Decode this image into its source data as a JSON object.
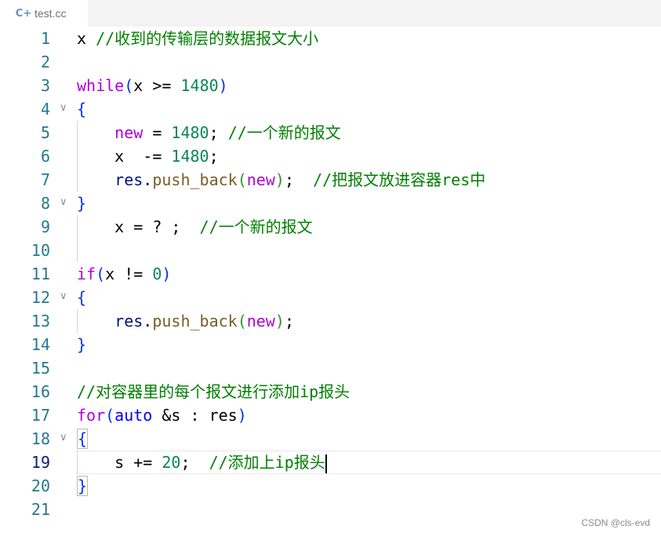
{
  "tab": {
    "title": "test.cc",
    "icon": "cpp-file-icon"
  },
  "watermark": "CSDN @cls-evd",
  "current_line": 19,
  "lines": [
    {
      "n": "1",
      "text": "x //收到的传输层的数据报文大小"
    },
    {
      "n": "2",
      "text": ""
    },
    {
      "n": "3",
      "text": "while(x >= 1480)"
    },
    {
      "n": "4",
      "text": "{"
    },
    {
      "n": "5",
      "text": "    new = 1480; //一个新的报文"
    },
    {
      "n": "6",
      "text": "    x  -= 1480;"
    },
    {
      "n": "7",
      "text": "    res.push_back(new);  //把报文放进容器res中"
    },
    {
      "n": "8",
      "text": "}"
    },
    {
      "n": "9",
      "text": "    x = ? ;  //一个新的报文"
    },
    {
      "n": "10",
      "text": ""
    },
    {
      "n": "11",
      "text": "if(x != 0)"
    },
    {
      "n": "12",
      "text": "{"
    },
    {
      "n": "13",
      "text": "    res.push_back(new);"
    },
    {
      "n": "14",
      "text": "}"
    },
    {
      "n": "15",
      "text": ""
    },
    {
      "n": "16",
      "text": "//对容器里的每个报文进行添加ip报头"
    },
    {
      "n": "17",
      "text": "for(auto &s : res)"
    },
    {
      "n": "18",
      "text": "{"
    },
    {
      "n": "19",
      "text": "    s += 20;  //添加上ip报头"
    },
    {
      "n": "20",
      "text": "}"
    },
    {
      "n": "21",
      "text": ""
    }
  ],
  "tokens": {
    "l1": [
      {
        "t": "x ",
        "c": ""
      },
      {
        "t": "//收到的传输层的数据报文大小",
        "c": "c"
      }
    ],
    "l3": [
      {
        "t": "while",
        "c": "k"
      },
      {
        "t": "(",
        "c": "b1"
      },
      {
        "t": "x >= ",
        "c": ""
      },
      {
        "t": "1480",
        "c": "n"
      },
      {
        "t": ")",
        "c": "b1"
      }
    ],
    "l4": [
      {
        "t": "{",
        "c": "b1"
      }
    ],
    "l5": [
      {
        "t": "    ",
        "c": ""
      },
      {
        "t": "new",
        "c": "k"
      },
      {
        "t": " = ",
        "c": ""
      },
      {
        "t": "1480",
        "c": "n"
      },
      {
        "t": "; ",
        "c": ""
      },
      {
        "t": "//一个新的报文",
        "c": "c"
      }
    ],
    "l6": [
      {
        "t": "    x  -= ",
        "c": ""
      },
      {
        "t": "1480",
        "c": "n"
      },
      {
        "t": ";",
        "c": ""
      }
    ],
    "l7": [
      {
        "t": "    ",
        "c": ""
      },
      {
        "t": "res",
        "c": "v"
      },
      {
        "t": ".",
        "c": ""
      },
      {
        "t": "push_back",
        "c": "f"
      },
      {
        "t": "(",
        "c": "b2"
      },
      {
        "t": "new",
        "c": "k"
      },
      {
        "t": ")",
        "c": "b2"
      },
      {
        "t": ";  ",
        "c": ""
      },
      {
        "t": "//把报文放进容器res中",
        "c": "c"
      }
    ],
    "l8": [
      {
        "t": "}",
        "c": "b1"
      }
    ],
    "l9": [
      {
        "t": "    x = ? ;  ",
        "c": ""
      },
      {
        "t": "//一个新的报文",
        "c": "c"
      }
    ],
    "l11": [
      {
        "t": "if",
        "c": "k"
      },
      {
        "t": "(",
        "c": "b1"
      },
      {
        "t": "x != ",
        "c": ""
      },
      {
        "t": "0",
        "c": "n"
      },
      {
        "t": ")",
        "c": "b1"
      }
    ],
    "l12": [
      {
        "t": "{",
        "c": "b1"
      }
    ],
    "l13": [
      {
        "t": "    ",
        "c": ""
      },
      {
        "t": "res",
        "c": "v"
      },
      {
        "t": ".",
        "c": ""
      },
      {
        "t": "push_back",
        "c": "f"
      },
      {
        "t": "(",
        "c": "b2"
      },
      {
        "t": "new",
        "c": "k"
      },
      {
        "t": ")",
        "c": "b2"
      },
      {
        "t": ";",
        "c": ""
      }
    ],
    "l14": [
      {
        "t": "}",
        "c": "b1"
      }
    ],
    "l16": [
      {
        "t": "//对容器里的每个报文进行添加ip报头",
        "c": "c"
      }
    ],
    "l17": [
      {
        "t": "for",
        "c": "k"
      },
      {
        "t": "(",
        "c": "b1"
      },
      {
        "t": "auto",
        "c": "t"
      },
      {
        "t": " &s : res",
        "c": ""
      },
      {
        "t": ")",
        "c": "b1"
      }
    ],
    "l18": [
      {
        "t": "{",
        "c": "b1 bb"
      }
    ],
    "l19": [
      {
        "t": "    s += ",
        "c": ""
      },
      {
        "t": "20",
        "c": "n"
      },
      {
        "t": ";  ",
        "c": ""
      },
      {
        "t": "//添加上ip报头",
        "c": "c"
      }
    ],
    "l20": [
      {
        "t": "}",
        "c": "b1 bb"
      }
    ]
  },
  "folds": [
    "4",
    "8",
    "12",
    "18"
  ]
}
